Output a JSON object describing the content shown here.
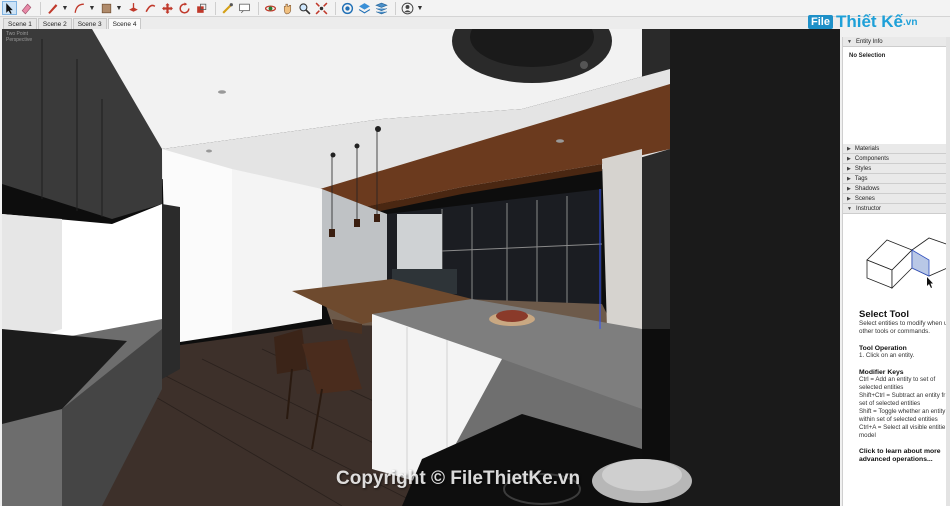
{
  "toolbar": {
    "tools": [
      {
        "name": "select-tool",
        "icon": "arrow-icon",
        "active": true
      },
      {
        "name": "eraser-tool",
        "icon": "eraser-icon"
      },
      {
        "name": "line-tool",
        "icon": "pencil-icon",
        "dropdown": true
      },
      {
        "name": "arc-tool",
        "icon": "arc-icon",
        "dropdown": true
      },
      {
        "name": "shape-tool",
        "icon": "rectangle-icon",
        "dropdown": true
      },
      {
        "name": "pushpull-tool",
        "icon": "pushpull-icon"
      },
      {
        "name": "followme-tool",
        "icon": "followme-icon"
      },
      {
        "name": "move-tool",
        "icon": "move-icon"
      },
      {
        "name": "rotate-tool",
        "icon": "rotate-icon"
      },
      {
        "name": "scale-tool",
        "icon": "scale-icon"
      },
      {
        "name": "tape-tool",
        "icon": "tape-icon"
      },
      {
        "name": "text-tool",
        "icon": "text-icon"
      },
      {
        "name": "orbit-tool",
        "icon": "orbit-icon"
      },
      {
        "name": "pan-tool",
        "icon": "hand-icon"
      },
      {
        "name": "zoom-tool",
        "icon": "magnifier-icon"
      },
      {
        "name": "zoom-extents-tool",
        "icon": "zoom-extents-icon"
      },
      {
        "name": "warehouse-tool",
        "icon": "warehouse-icon"
      },
      {
        "name": "extension-tool",
        "icon": "extension-icon"
      },
      {
        "name": "layers-tool",
        "icon": "layers-icon"
      },
      {
        "name": "account-tool",
        "icon": "user-icon",
        "dropdown": true
      }
    ]
  },
  "scenes": [
    "Scene 1",
    "Scene 2",
    "Scene 3",
    "Scene 4"
  ],
  "active_scene": 3,
  "viewport": {
    "label_line1": "Two Point",
    "label_line2": "Perspective"
  },
  "watermark": "Copyright © FileThietKe.vn",
  "logo": {
    "badge": "File",
    "text": "Thiết Kế",
    "domain": ".vn"
  },
  "tray": {
    "entity_info": {
      "title": "Entity Info",
      "value": "No Selection"
    },
    "panels": [
      "Materials",
      "Components",
      "Styles",
      "Tags",
      "Shadows",
      "Scenes"
    ],
    "instructor": {
      "title": "Instructor",
      "tool_name": "Select Tool",
      "description": [
        "Select entities to modify when u",
        "other tools or commands."
      ],
      "operation_heading": "Tool Operation",
      "operation_steps": [
        "1. Click on an entity."
      ],
      "modifier_heading": "Modifier Keys",
      "modifier_lines": [
        "Ctrl = Add an entity to set of",
        "selected entities",
        "Shift+Ctrl = Subtract an entity fr",
        "set of selected entities",
        "Shift = Toggle whether an entity",
        "within set of selected entities",
        "Ctrl+A = Select all visible entitie",
        "model"
      ],
      "link_line1": "Click to learn about more",
      "link_line2": "advanced operations..."
    }
  },
  "colors": {
    "accent": "#1ea0d8",
    "toolbar_bg": "#f3f3f3",
    "tray_bg": "#f7f7f7",
    "wood_ceiling": "#6b3a1e",
    "counter_grey": "#7e7e7e",
    "floor": "#4a3a30"
  }
}
